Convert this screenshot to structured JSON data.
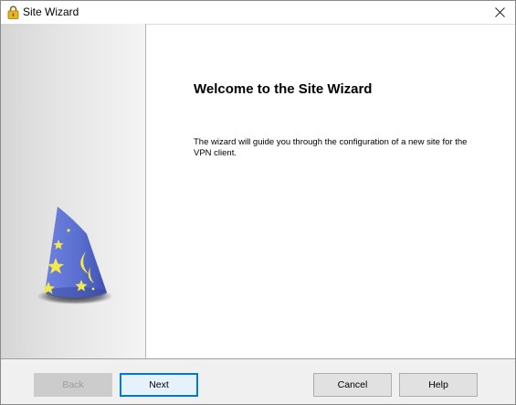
{
  "window": {
    "title": "Site Wizard",
    "app_icon": "padlock-icon",
    "close_icon": "close-icon"
  },
  "side_panel": {
    "illustration": "wizard-hat-icon"
  },
  "content": {
    "heading": "Welcome to the Site Wizard",
    "description": "The wizard will guide you through the configuration of a new site for the VPN client."
  },
  "buttons": {
    "back": "Back",
    "next": "Next",
    "cancel": "Cancel",
    "help": "Help"
  },
  "colors": {
    "accent": "#0078d7",
    "hat_body": "#5a6fd0",
    "hat_stars": "#f2e84a"
  }
}
